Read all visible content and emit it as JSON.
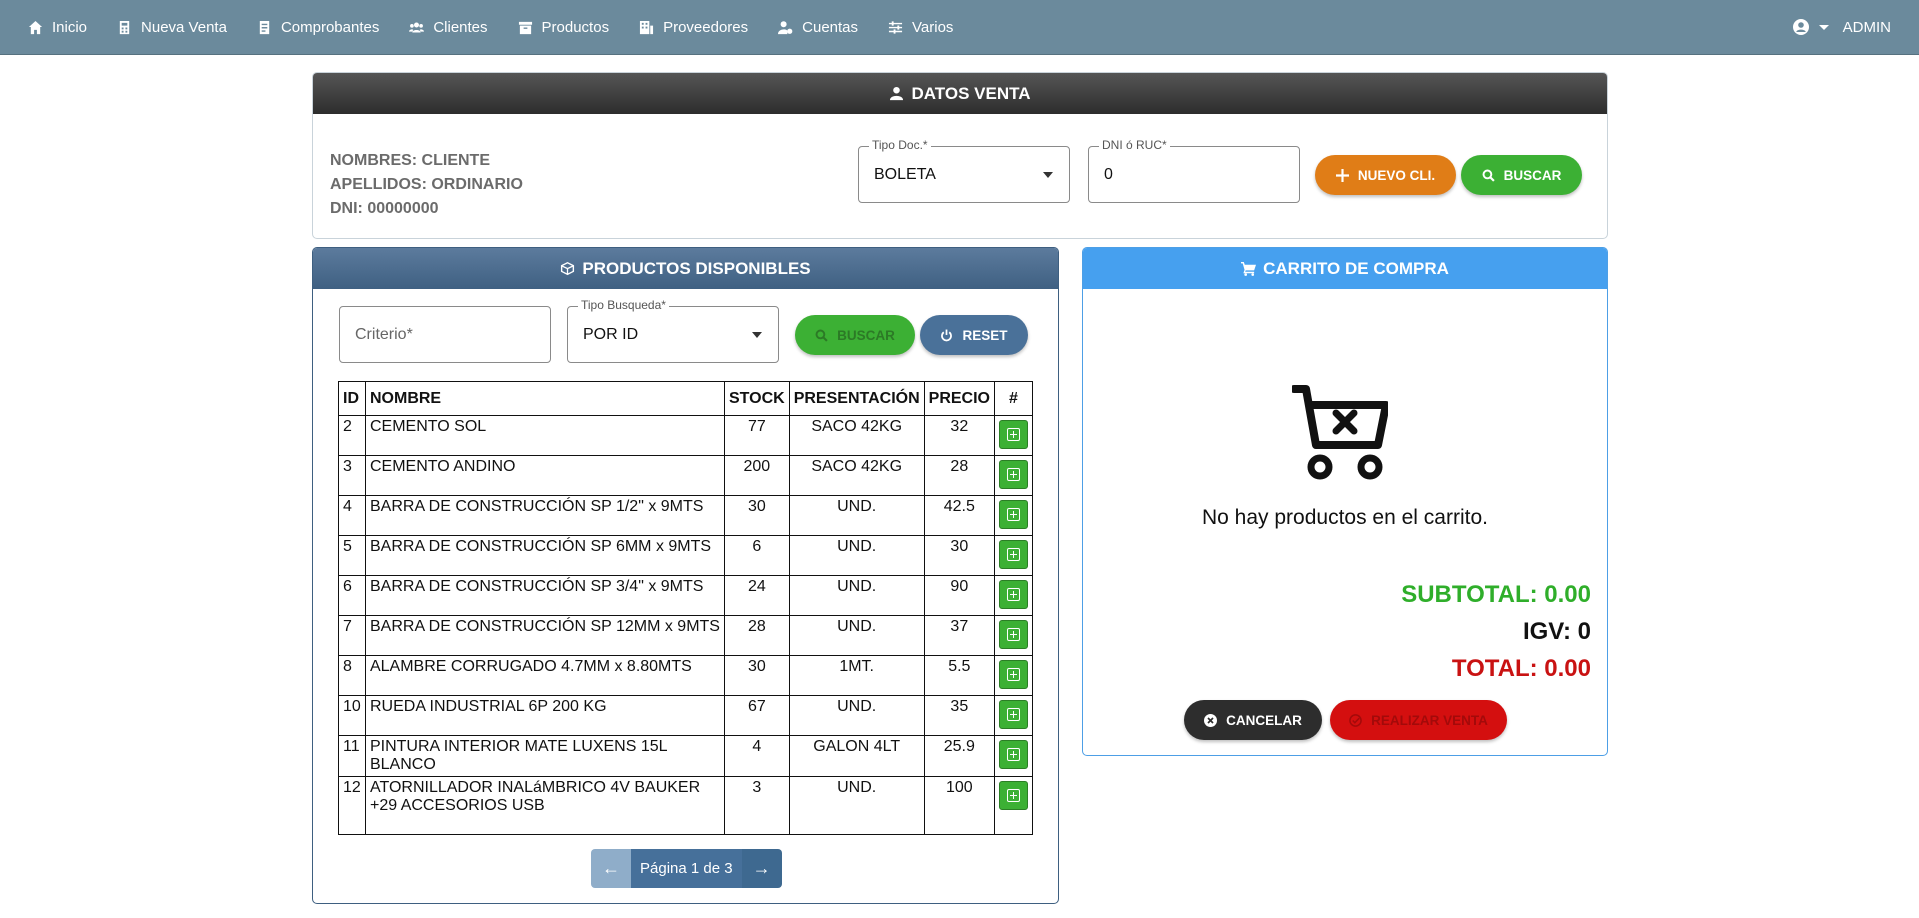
{
  "navbar": {
    "items": [
      {
        "label": "Inicio",
        "icon": "home-icon"
      },
      {
        "label": "Nueva Venta",
        "icon": "register-icon"
      },
      {
        "label": "Comprobantes",
        "icon": "receipt-icon"
      },
      {
        "label": "Clientes",
        "icon": "users-icon"
      },
      {
        "label": "Productos",
        "icon": "box-icon"
      },
      {
        "label": "Proveedores",
        "icon": "building-icon"
      },
      {
        "label": "Cuentas",
        "icon": "user-gear-icon"
      },
      {
        "label": "Varios",
        "icon": "sliders-icon"
      }
    ],
    "user": "ADMIN"
  },
  "datos_venta": {
    "title": "DATOS VENTA",
    "nombres": "NOMBRES: CLIENTE",
    "apellidos": "APELLIDOS: ORDINARIO",
    "dni": "DNI: 00000000",
    "tipo_doc_label": "Tipo Doc.*",
    "tipo_doc_value": "BOLETA",
    "dni_ruc_label": "DNI ó RUC*",
    "dni_ruc_value": "0",
    "nuevo_cli": "NUEVO CLI.",
    "buscar": "BUSCAR"
  },
  "productos": {
    "title": "PRODUCTOS DISPONIBLES",
    "criterio_placeholder": "Criterio*",
    "tipo_busqueda_label": "Tipo Busqueda*",
    "tipo_busqueda_value": "POR ID",
    "buscar": "BUSCAR",
    "reset": "RESET",
    "columns": [
      "ID",
      "NOMBRE",
      "STOCK",
      "PRESENTACIÓN",
      "PRECIO",
      "#"
    ],
    "rows": [
      {
        "id": "2",
        "nombre": "CEMENTO SOL",
        "stock": "77",
        "presentacion": "SACO 42KG",
        "precio": "32"
      },
      {
        "id": "3",
        "nombre": "CEMENTO ANDINO",
        "stock": "200",
        "presentacion": "SACO 42KG",
        "precio": "28"
      },
      {
        "id": "4",
        "nombre": "BARRA DE CONSTRUCCIÓN SP 1/2\" x 9MTS",
        "stock": "30",
        "presentacion": "UND.",
        "precio": "42.5"
      },
      {
        "id": "5",
        "nombre": "BARRA DE CONSTRUCCIÓN SP 6MM x 9MTS",
        "stock": "6",
        "presentacion": "UND.",
        "precio": "30"
      },
      {
        "id": "6",
        "nombre": "BARRA DE CONSTRUCCIÓN SP 3/4\" x 9MTS",
        "stock": "24",
        "presentacion": "UND.",
        "precio": "90"
      },
      {
        "id": "7",
        "nombre": "BARRA DE CONSTRUCCIÓN SP 12MM x 9MTS",
        "stock": "28",
        "presentacion": "UND.",
        "precio": "37"
      },
      {
        "id": "8",
        "nombre": "ALAMBRE CORRUGADO 4.7MM x 8.80MTS",
        "stock": "30",
        "presentacion": "1MT.",
        "precio": "5.5"
      },
      {
        "id": "10",
        "nombre": "RUEDA INDUSTRIAL 6P 200 KG",
        "stock": "67",
        "presentacion": "UND.",
        "precio": "35"
      },
      {
        "id": "11",
        "nombre": "PINTURA INTERIOR MATE LUXENS 15L BLANCO",
        "stock": "4",
        "presentacion": "GALON 4LT",
        "precio": "25.9"
      },
      {
        "id": "12",
        "nombre": "ATORNILLADOR INALáMBRICO 4V BAUKER +29 ACCESORIOS USB",
        "stock": "3",
        "presentacion": "UND.",
        "precio": "100"
      }
    ],
    "pagination": "Página 1 de 3"
  },
  "carrito": {
    "title": "CARRITO DE COMPRA",
    "empty_text": "No hay productos en el carrito.",
    "subtotal": "SUBTOTAL: 0.00",
    "igv": "IGV: 0",
    "total": "TOTAL: 0.00",
    "cancelar": "CANCELAR",
    "realizar_venta": "REALIZAR VENTA"
  },
  "colors": {
    "navbar": "#6b8a9c",
    "green": "#3cb034",
    "orange": "#e07d17",
    "red": "#d40f0f",
    "subtotal_green": "#2fae2a",
    "total_red": "#c91212"
  }
}
